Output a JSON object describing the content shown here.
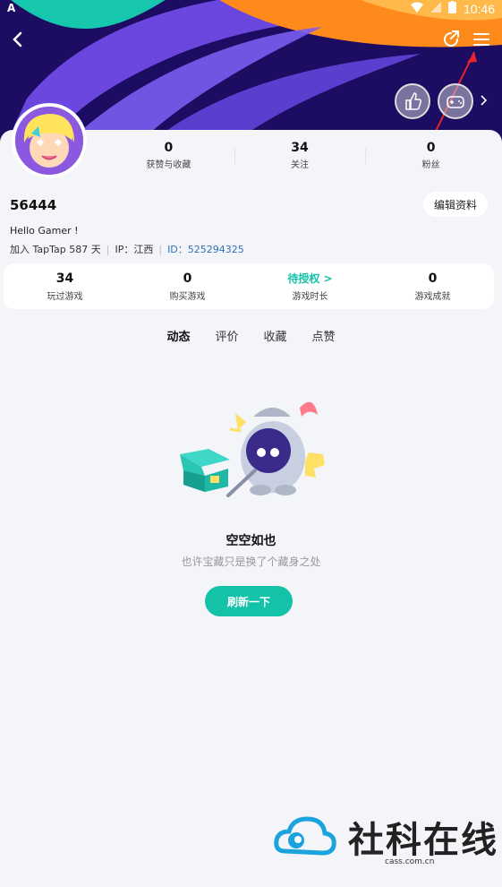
{
  "statusbar": {
    "time": "10:46",
    "left_indicator": "A"
  },
  "profile": {
    "username": "56444",
    "bio": "Hello Gamer !",
    "joined": "加入 TapTap 587 天",
    "ip": "IP：江西",
    "uid": "ID：525294325",
    "edit_label": "编辑资料"
  },
  "top_stats": [
    {
      "value": "0",
      "label": "获赞与收藏"
    },
    {
      "value": "34",
      "label": "关注"
    },
    {
      "value": "0",
      "label": "粉丝"
    }
  ],
  "game_stats": [
    {
      "value": "34",
      "label": "玩过游戏"
    },
    {
      "value": "0",
      "label": "购买游戏"
    },
    {
      "value": "待授权 >",
      "label": "游戏时长"
    },
    {
      "value": "0",
      "label": "游戏成就"
    }
  ],
  "tabs": [
    {
      "label": "动态"
    },
    {
      "label": "评价"
    },
    {
      "label": "收藏"
    },
    {
      "label": "点赞"
    }
  ],
  "empty": {
    "title": "空空如也",
    "subtitle": "也许宝藏只是换了个藏身之处",
    "refresh_label": "刷新一下"
  },
  "watermark": {
    "text": "社科在线",
    "sub": "cass.com.cn"
  },
  "colors": {
    "accent": "#14c2a8",
    "banner": "#1c0d63",
    "uid": "#2f6fb8"
  }
}
